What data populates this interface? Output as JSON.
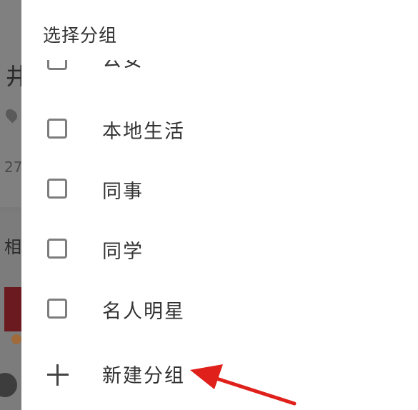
{
  "background": {
    "title_glyph": "井",
    "number_text": "27",
    "section_glyph": "相"
  },
  "dialog": {
    "title": "选择分组",
    "groups": [
      {
        "label": "公安",
        "checked": false
      },
      {
        "label": "本地生活",
        "checked": false
      },
      {
        "label": "同事",
        "checked": false
      },
      {
        "label": "同学",
        "checked": false
      },
      {
        "label": "名人明星",
        "checked": false
      }
    ],
    "new_group_label": "新建分组"
  },
  "annotation": {
    "arrow_color": "#e0201b"
  }
}
